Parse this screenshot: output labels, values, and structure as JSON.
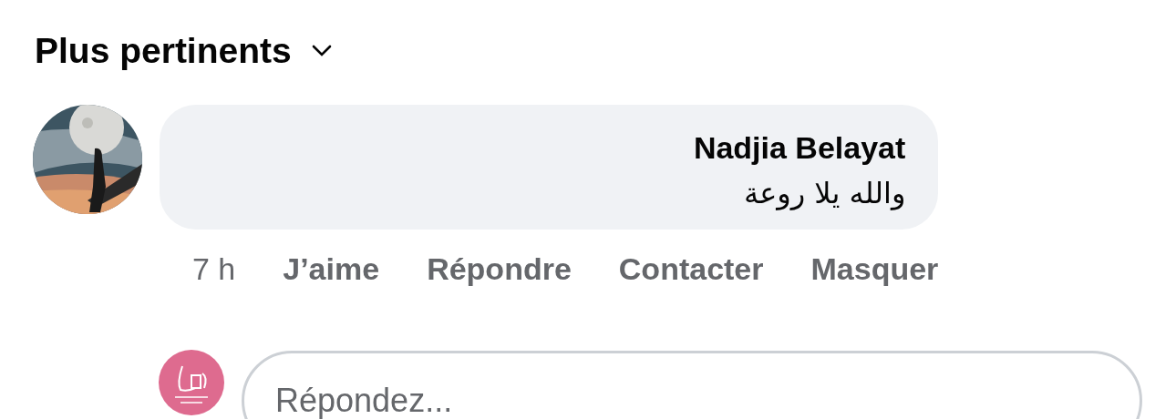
{
  "sort": {
    "label": "Plus pertinents"
  },
  "comment": {
    "author": "Nadjia Belayat",
    "text": "والله يلا روعة",
    "time": "7 h",
    "actions": [
      "J’aime",
      "Répondre",
      "Contacter",
      "Masquer"
    ]
  },
  "reply": {
    "placeholder": "Répondez..."
  }
}
